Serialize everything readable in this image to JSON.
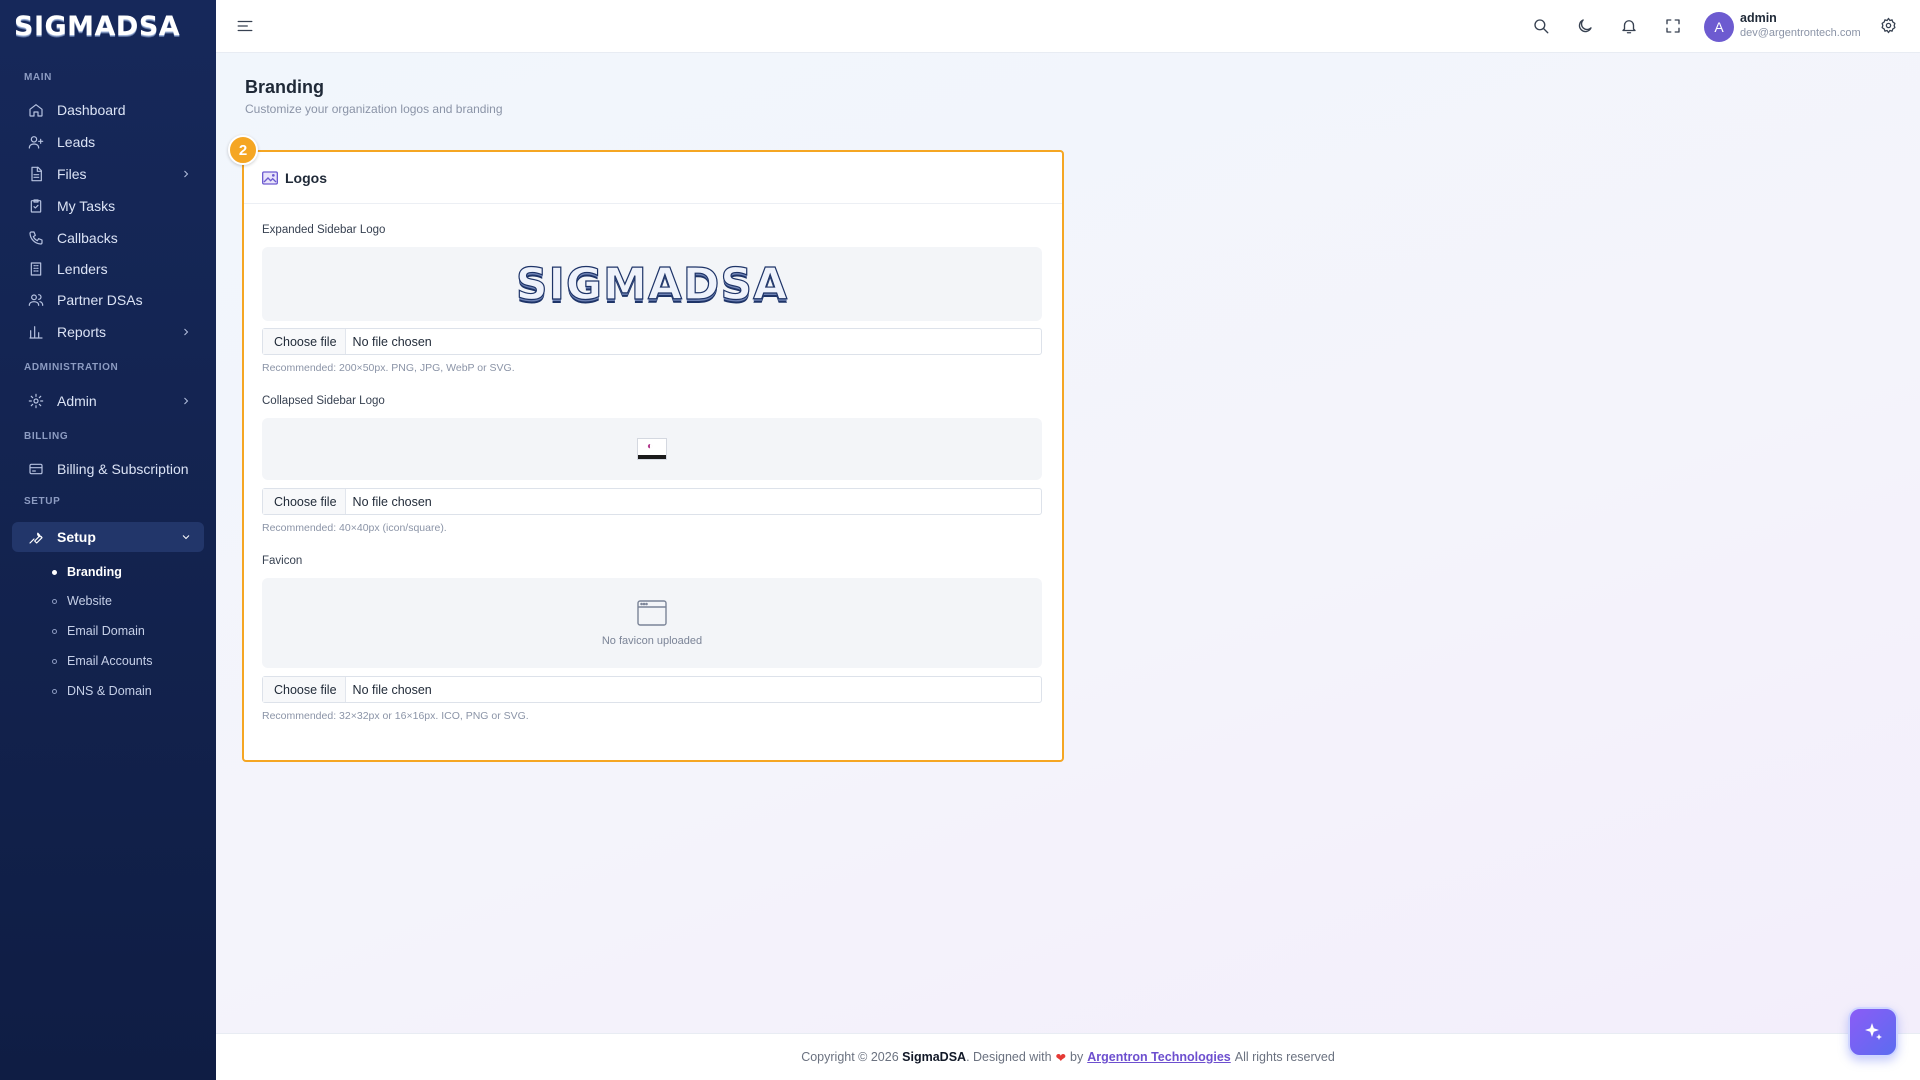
{
  "brand": {
    "name": "SIGMADSA"
  },
  "sidebar": {
    "sections": {
      "main": "MAIN",
      "administration": "ADMINISTRATION",
      "billing": "BILLING",
      "setup": "SETUP"
    },
    "items": {
      "dashboard": "Dashboard",
      "leads": "Leads",
      "files": "Files",
      "tasks": "My Tasks",
      "callbacks": "Callbacks",
      "lenders": "Lenders",
      "partners": "Partner DSAs",
      "reports": "Reports",
      "admin": "Admin",
      "billing": "Billing & Subscription",
      "setup": "Setup"
    },
    "setup_children": [
      "Branding",
      "Website",
      "Email Domain",
      "Email Accounts",
      "DNS & Domain"
    ]
  },
  "topbar": {
    "user_initial": "A",
    "user_name": "admin",
    "user_email": "dev@argentrontech.com"
  },
  "page": {
    "title": "Branding",
    "subtitle": "Customize your organization logos and branding"
  },
  "card": {
    "step": "2",
    "title": "Logos",
    "expanded": {
      "label": "Expanded Sidebar Logo",
      "preview_text": "SIGMADSA",
      "button": "Choose file",
      "status": "No file chosen",
      "hint": "Recommended: 200×50px. PNG, JPG, WebP or SVG."
    },
    "collapsed": {
      "label": "Collapsed Sidebar Logo",
      "button": "Choose file",
      "status": "No file chosen",
      "hint": "Recommended: 40×40px (icon/square)."
    },
    "favicon": {
      "label": "Favicon",
      "empty_text": "No favicon uploaded",
      "button": "Choose file",
      "status": "No file chosen",
      "hint": "Recommended: 32×32px or 16×16px. ICO, PNG or SVG."
    }
  },
  "footer": {
    "prefix": "Copyright © 2026",
    "product": "SigmaDSA",
    "designed": ". Designed with",
    "by": "by",
    "company": "Argentron Technologies",
    "suffix": "All rights reserved"
  },
  "colors": {
    "accent": "#f5a623",
    "sidebar": "#16285a",
    "primary": "#6d5bd0"
  }
}
